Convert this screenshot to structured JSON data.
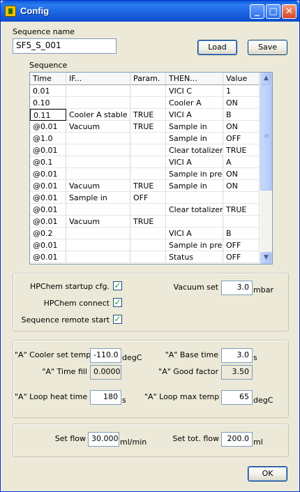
{
  "window": {
    "title": "Config"
  },
  "sequence_name": {
    "label": "Sequence name",
    "value": "SF5_S_001"
  },
  "buttons": {
    "load": "Load",
    "save": "Save",
    "ok": "OK"
  },
  "sequence": {
    "label": "Sequence",
    "columns": [
      "Time",
      "IF...",
      "Param.",
      "THEN...",
      "Value"
    ],
    "rows": [
      [
        "0.01",
        "",
        "",
        "VICI C",
        "1"
      ],
      [
        "0.10",
        "",
        "",
        "Cooler A",
        "ON"
      ],
      [
        "0.11",
        "Cooler A stable",
        "TRUE",
        "VICI A",
        "B"
      ],
      [
        "@0.01",
        "Vacuum",
        "TRUE",
        "Sample in",
        "ON"
      ],
      [
        "@1.0",
        "",
        "",
        "Sample in",
        "OFF"
      ],
      [
        "@0.01",
        "",
        "",
        "Clear totalizer",
        "TRUE"
      ],
      [
        "@0.1",
        "",
        "",
        "VICI A",
        "A"
      ],
      [
        "@0.01",
        "",
        "",
        "Sample in pre",
        "ON"
      ],
      [
        "@0.01",
        "Vacuum",
        "TRUE",
        "Sample in",
        "ON"
      ],
      [
        "@0.01",
        "Sample in",
        "OFF",
        "",
        ""
      ],
      [
        "@0.01",
        "",
        "",
        "Clear totalizer",
        "TRUE"
      ],
      [
        "@0.01",
        "Vacuum",
        "TRUE",
        "",
        ""
      ],
      [
        "@0.2",
        "",
        "",
        "VICI A",
        "B"
      ],
      [
        "@0.01",
        "",
        "",
        "Sample in pre",
        "OFF"
      ],
      [
        "@0.01",
        "",
        "",
        "Status",
        "OFF"
      ]
    ]
  },
  "hpchem": {
    "startup_label": "HPChem startup cfg.",
    "startup_checked": true,
    "connect_label": "HPChem connect",
    "connect_checked": true,
    "remote_label": "Sequence remote start",
    "remote_checked": true,
    "vacuum_label": "Vacuum set",
    "vacuum_value": "3.0",
    "vacuum_unit": "mbar"
  },
  "cooler": {
    "cooler_temp_label": "\"A\" Cooler set temp.",
    "cooler_temp_value": "-110.0",
    "cooler_temp_unit": "degC",
    "base_time_label": "\"A\" Base time",
    "base_time_value": "3.0",
    "base_time_unit": "s",
    "time_fill_label": "\"A\" Time fill",
    "time_fill_value": "0.0000",
    "good_factor_label": "\"A\" Good factor",
    "good_factor_value": "3.50",
    "heat_time_label": "\"A\" Loop heat time",
    "heat_time_value": "180",
    "heat_time_unit": "s",
    "max_temp_label": "\"A\" Loop max temp",
    "max_temp_value": "65",
    "max_temp_unit": "degC"
  },
  "flow": {
    "set_flow_label": "Set flow",
    "set_flow_value": "30.000",
    "set_flow_unit": "ml/min",
    "tot_flow_label": "Set tot. flow",
    "tot_flow_value": "200.0",
    "tot_flow_unit": "ml"
  },
  "icons": {
    "check_glyph": "✓",
    "minimize_glyph": "_",
    "maximize_glyph": "□",
    "close_glyph": "✕",
    "scroll_up_glyph": "▲",
    "scroll_down_glyph": "▼"
  }
}
